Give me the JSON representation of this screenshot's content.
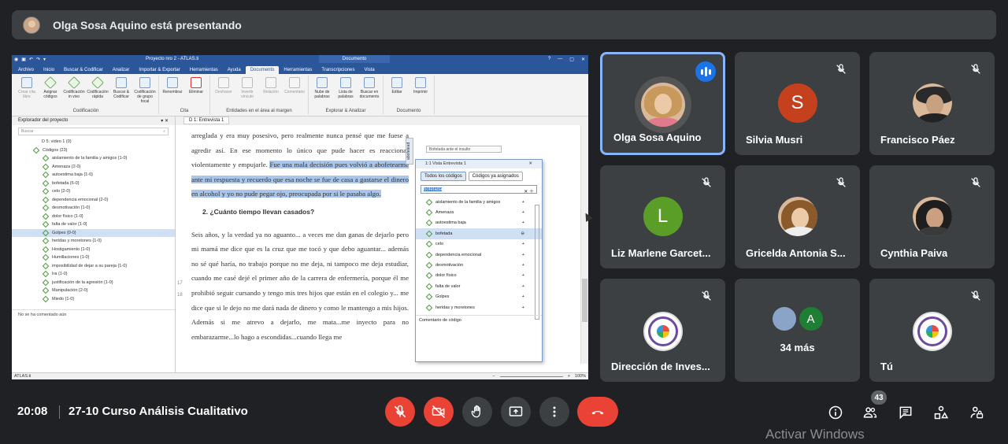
{
  "presenting": {
    "text": "Olga Sosa Aquino está presentando"
  },
  "shared_screen": {
    "app_title": "Proyecto nro 2 - ATLAS.ti",
    "doc_tab_header": "Documento",
    "menu": [
      "Archivo",
      "Inicio",
      "Buscar & Codificar",
      "Analizar",
      "Importar & Exportar",
      "Herramientas",
      "Ayuda",
      "Documento",
      "Herramientas",
      "Transcripciones",
      "Vista"
    ],
    "ribbon": {
      "groups": [
        {
          "label": "Codificación",
          "buttons": [
            "Crear cita libre",
            "Asignar códigos",
            "Codificación in vivo",
            "Codificación rápida",
            "Buscar & Codificar",
            "Codificación de grupo focal"
          ]
        },
        {
          "label": "Cita",
          "buttons": [
            "Renombrar",
            "Eliminar"
          ]
        },
        {
          "label": "Entidades en el área al margen",
          "buttons": [
            "Deshacer",
            "Invertir vínculo",
            "Relación",
            "Comentario"
          ]
        },
        {
          "label": "Explorar & Analizar",
          "buttons": [
            "Nube de palabras",
            "Lista de palabras",
            "Buscar en documento"
          ]
        },
        {
          "label": "Documento",
          "buttons": [
            "Editar",
            "Imprimir"
          ]
        }
      ]
    },
    "explorer": {
      "title": "Explorador del proyecto",
      "search_placeholder": "Buscar",
      "video_item": "D 5: video 1 (0)",
      "codes_root": "Códigos (23)",
      "codes": [
        "aislamiento de la familia y amigos {1-0}",
        "Amenaza {2-0}",
        "autoestima baja {1-0}",
        "bofetada {6-0}",
        "celo {2-0}",
        "dependencia emocional {2-0}",
        "desmotivación {1-0}",
        "dolor físico {1-0}",
        "falta de valor {1-0}",
        "Golpes {0-0}",
        "heridas y moretones {1-0}",
        "Hostigamiento {1-0}",
        "Humillaciones {1-0}",
        "imposibilidad de dejar a su pareja {1-0}",
        "Ira {1-0}",
        "justificación de la agresión {1-0}",
        "Manipulación {2-0}",
        "Miedo {1-0}"
      ],
      "selected_index": 9,
      "footer": "No se ha comentado aún"
    },
    "document": {
      "tab": "D 1: Entrevista 1",
      "para1_a": "arreglada y era muy posesivo, pero realmente nunca pensé que me fuese a agredir así. En ese momento lo único que pude hacer es reaccionar violentamente y empujarle. ",
      "para1_hl": "Fue una mala decisión pues volvió a abofetearme ante mi respuesta y recuerdo que esa noche se fue de casa a gastarse el dinero en alcohol y yo no pude pegar ojo, preocupada por si le pasaba algo.",
      "heading": "2.  ¿Cuánto tiempo llevan casados?",
      "para2": "Seis años, y la verdad ya no aguanto... a veces me dan ganas de dejarlo pero mi mamá me dice que es la cruz que me tocó y que debo aguantar... además no sé qué haría, no trabajo porque no me deja, ni tampoco me deja estudiar, cuando me casé dejé el primer año de la carrera de enfermería, porque él me prohibió seguir cursando y tengo mis tres hijos que están en el colegio  y... me dice que si le dejo no me dará nada de dinero y  como le mantengo a mis hijos. Además si me atrevo a dejarlo, me mata...me inyecto para no embarazarme...lo hago a escondidas...cuando llega me",
      "line_numbers": [
        "17",
        "18"
      ]
    },
    "margin": {
      "strip": "abofetead",
      "code": "Bofetada ante el insulto"
    },
    "code_popup": {
      "title": "1:1 Vista Entrevista 1",
      "tabs": [
        "Todos los códigos",
        "Códigos ya asignados"
      ],
      "search_value": "bofetada",
      "codes": [
        "aislamiento de la familia y amigos",
        "Amenaza",
        "autoestima baja",
        "bofetada",
        "celo",
        "dependencia emocional",
        "desmotivación",
        "dolor físico",
        "falta de valor",
        "Golpes",
        "heridas y moretones"
      ],
      "selected_index": 3,
      "footer": "Comentario de código"
    },
    "status": {
      "left": "ATLAS.ti",
      "zoom": "100%"
    }
  },
  "participants": [
    {
      "name": "Olga Sosa Aquino",
      "speaking": true
    },
    {
      "name": "Silvia Musri",
      "initial": "S",
      "color": "#c5401c"
    },
    {
      "name": "Francisco Páez"
    },
    {
      "name": "Liz Marlene Garcet...",
      "initial": "L",
      "color": "#5a9e27"
    },
    {
      "name": "Gricelda Antonia S..."
    },
    {
      "name": "Cynthia Paiva"
    },
    {
      "name": "Dirección de Inves..."
    },
    {
      "name": "34 más",
      "initial": "A",
      "color": "#1e7e34"
    },
    {
      "name": "Tú"
    }
  ],
  "bottom_bar": {
    "time": "20:08",
    "meeting_name": "27-10 Curso Análisis Cualitativo",
    "participants_count": "43",
    "watermark": "Activar Windows"
  },
  "colors": {
    "background": "#202124",
    "tile": "#3c4043",
    "accent": "#8ab4f8",
    "danger": "#ea4335"
  }
}
